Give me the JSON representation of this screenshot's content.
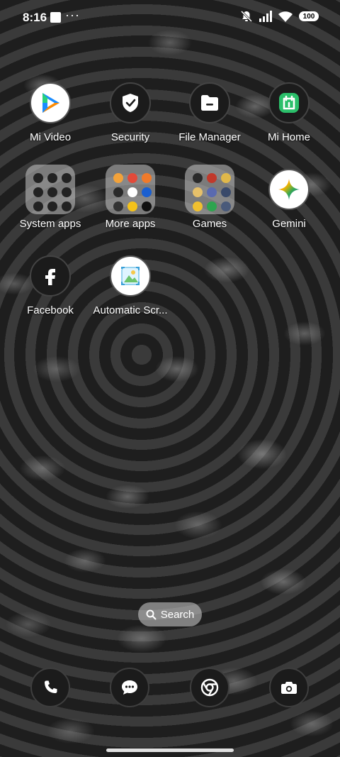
{
  "status_bar": {
    "time": "8:16",
    "dots": "···",
    "battery": "100",
    "icons": [
      "notification-square-icon",
      "mute-icon",
      "signal-icon",
      "wifi-icon",
      "battery-icon"
    ]
  },
  "apps": [
    {
      "label": "Mi Video",
      "icon": "play-icon"
    },
    {
      "label": "Security",
      "icon": "shield-icon"
    },
    {
      "label": "File Manager",
      "icon": "folder-icon"
    },
    {
      "label": "Mi Home",
      "icon": "home-icon"
    },
    {
      "label": "System apps",
      "icon": "folder-grid-icon"
    },
    {
      "label": "More apps",
      "icon": "folder-grid-icon"
    },
    {
      "label": "Games",
      "icon": "folder-grid-icon"
    },
    {
      "label": "Gemini",
      "icon": "sparkle-icon"
    },
    {
      "label": "Facebook",
      "icon": "facebook-icon"
    },
    {
      "label": "Automatic Scr...",
      "icon": "gallery-icon"
    }
  ],
  "search": {
    "label": "Search",
    "icon": "search-icon"
  },
  "dock": [
    {
      "name": "phone",
      "icon": "phone-icon"
    },
    {
      "name": "messages",
      "icon": "message-icon"
    },
    {
      "name": "chrome",
      "icon": "chrome-icon"
    },
    {
      "name": "camera",
      "icon": "camera-icon"
    }
  ],
  "colors": {
    "mi_home_green": "#2bbf6a",
    "gemini_blue": "#4a7cf0",
    "play_blue": "#1a8cff",
    "play_orange": "#ff8a00"
  }
}
